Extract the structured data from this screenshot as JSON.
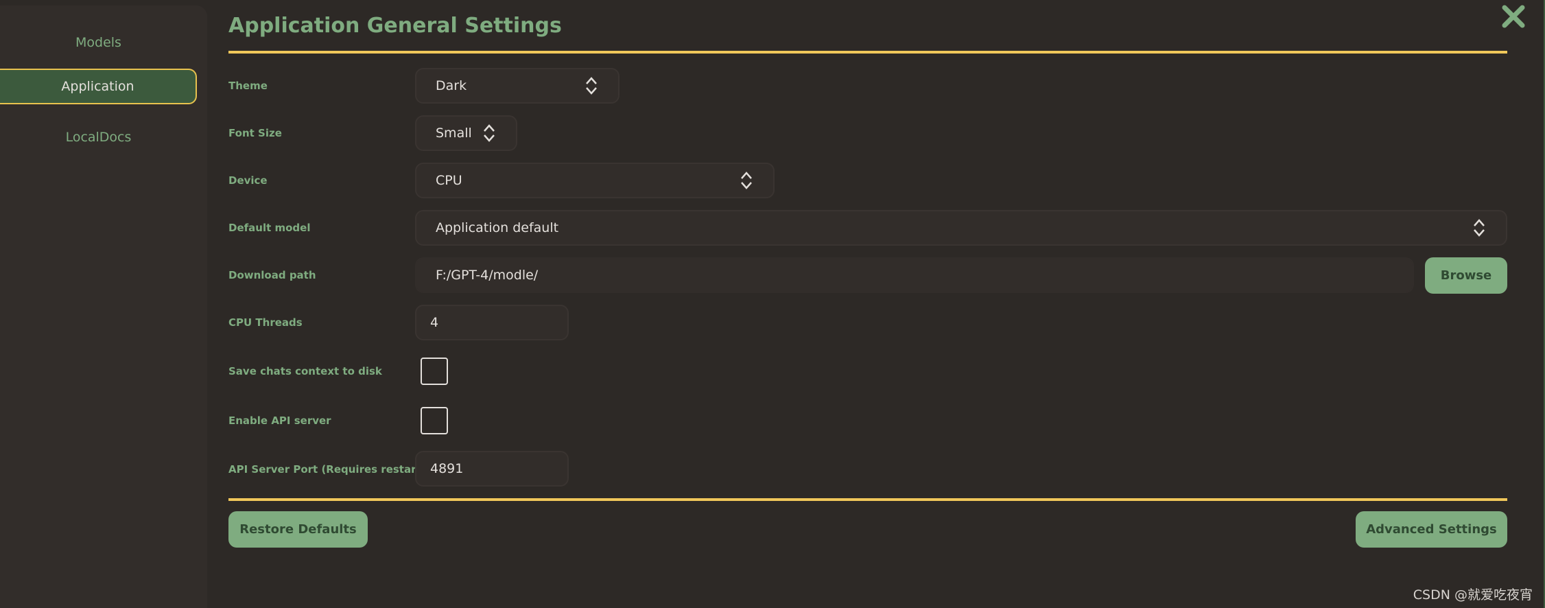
{
  "sidebar": {
    "items": [
      {
        "label": "Models"
      },
      {
        "label": "Application",
        "active": true
      },
      {
        "label": "LocalDocs"
      }
    ]
  },
  "header": {
    "title": "Application General Settings"
  },
  "settings": {
    "theme": {
      "label": "Theme",
      "value": "Dark"
    },
    "font_size": {
      "label": "Font Size",
      "value": "Small"
    },
    "device": {
      "label": "Device",
      "value": "CPU"
    },
    "default_model": {
      "label": "Default model",
      "value": "Application default"
    },
    "download_path": {
      "label": "Download path",
      "value": "F:/GPT-4/modle/",
      "browse_label": "Browse"
    },
    "cpu_threads": {
      "label": "CPU Threads",
      "value": "4"
    },
    "save_chats": {
      "label": "Save chats context to disk",
      "checked": false
    },
    "enable_api": {
      "label": "Enable API server",
      "checked": false
    },
    "api_port": {
      "label": "API Server Port (Requires restart):",
      "value": "4891"
    }
  },
  "footer": {
    "restore_label": "Restore Defaults",
    "advanced_label": "Advanced Settings"
  },
  "watermark": "CSDN @就爱吃夜宵",
  "icons": {
    "close": "close-icon",
    "spinner": "up-down-chevron-icon"
  },
  "colors": {
    "accent": "#7fac80",
    "divider": "#f0c75a",
    "active_bg": "#3c5a3d",
    "background": "#2d2926"
  }
}
